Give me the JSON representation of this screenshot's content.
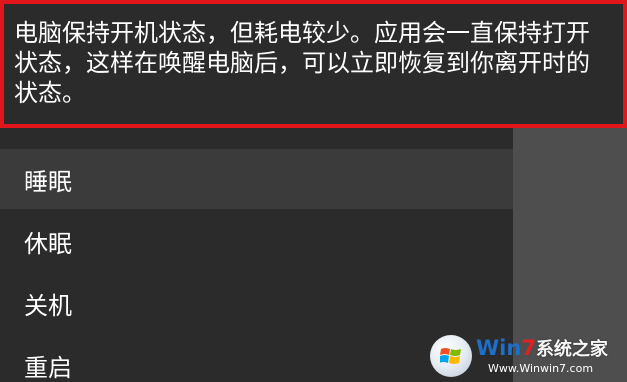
{
  "tooltip": {
    "text": "电脑保持开机状态，但耗电较少。应用会一直保持打开状态，这样在唤醒电脑后，可以立即恢复到你离开时的状态。",
    "highlight_color": "#e0161b"
  },
  "menu": {
    "items": [
      {
        "label": "睡眠",
        "selected": true
      },
      {
        "label": "休眠",
        "selected": false
      },
      {
        "label": "关机",
        "selected": false
      },
      {
        "label": "重启",
        "selected": false
      }
    ]
  },
  "watermark": {
    "brand_prefix": "Win",
    "brand_num": "7",
    "brand_suffix": "系统之家",
    "url": "Www.Winwin7.com",
    "logo_icon": "windows-logo-icon"
  }
}
